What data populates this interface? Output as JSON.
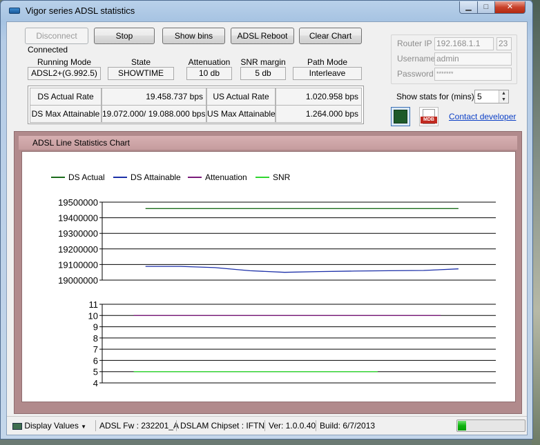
{
  "window": {
    "title": "Vigor series ADSL statistics"
  },
  "toolbar": {
    "disconnect": "Disconnect",
    "stop": "Stop",
    "show_bins": "Show bins",
    "adsl_reboot": "ADSL Reboot",
    "clear_chart": "Clear Chart"
  },
  "status": {
    "connection": "Connected"
  },
  "line": {
    "headers": {
      "running_mode": "Running Mode",
      "state": "State",
      "attenuation": "Attenuation",
      "snr_margin": "SNR margin",
      "path_mode": "Path Mode"
    },
    "values": {
      "running_mode": "ADSL2+(G.992.5)",
      "state": "SHOWTIME",
      "attenuation": "10 db",
      "snr_margin": "5 db",
      "path_mode": "Interleave"
    }
  },
  "rates": {
    "ds_actual_label": "DS Actual Rate",
    "ds_actual_value": "19.458.737 bps",
    "us_actual_label": "US Actual Rate",
    "us_actual_value": "1.020.958 bps",
    "ds_max_label": "DS Max Attainable",
    "ds_max_value": "19.072.000/ 19.088.000 bps",
    "us_max_label": "US Max Attainable",
    "us_max_value": "1.264.000 bps"
  },
  "login": {
    "router_ip_label": "Router IP",
    "router_ip": "192.168.1.1",
    "port": "23",
    "username_label": "Username",
    "username": "admin",
    "password_label": "Password",
    "password": "*******"
  },
  "stats": {
    "label": "Show stats for (mins)",
    "minutes": "5"
  },
  "icons": {
    "chart": "chart-icon",
    "mdb": "mdb-icon",
    "mdb_text": "MDB"
  },
  "contact": "Contact developer",
  "chart_header": "ADSL Line Statistics Chart",
  "colors": {
    "ds_actual": "#1a6b1a",
    "ds_attainable": "#1b2fa8",
    "attenuation": "#7a1a7a",
    "snr": "#2ed62e"
  },
  "chart_data": [
    {
      "type": "line",
      "title": "",
      "legend": [
        "DS Actual",
        "DS Attainable",
        "Attenuation",
        "SNR"
      ],
      "legend_position": "top-left",
      "yticks": [
        "19500000",
        "19400000",
        "19300000",
        "19200000",
        "19100000",
        "19000000"
      ],
      "ylim": [
        19000000,
        19500000
      ],
      "grid": true,
      "series": [
        {
          "name": "DS Actual",
          "values": [
            19458737,
            19458737,
            19458737,
            19458737,
            19458737,
            19458737,
            19458737,
            19458737,
            19458737,
            19458737
          ]
        },
        {
          "name": "DS Attainable",
          "values": [
            19088000,
            19088000,
            19080000,
            19060000,
            19050000,
            19055000,
            19058000,
            19060000,
            19062000,
            19072000
          ]
        }
      ]
    },
    {
      "type": "line",
      "title": "",
      "yticks": [
        "11",
        "10",
        "9",
        "8",
        "7",
        "6",
        "5",
        "4"
      ],
      "ylim": [
        4,
        11
      ],
      "grid": true,
      "series": [
        {
          "name": "Attenuation",
          "values": [
            10,
            10,
            10,
            10,
            10,
            10,
            10,
            10,
            10,
            10
          ]
        },
        {
          "name": "SNR",
          "values": [
            5,
            5,
            5,
            5,
            5,
            5,
            5,
            5
          ]
        }
      ]
    }
  ],
  "statusbar": {
    "display_values": "Display Values",
    "adsl_fw": "ADSL Fw : 232201_A",
    "dslam": "DSLAM Chipset : IFTN",
    "ver": "Ver: 1.0.0.40",
    "build": "Build: 6/7/2013",
    "progress": 0.12
  }
}
